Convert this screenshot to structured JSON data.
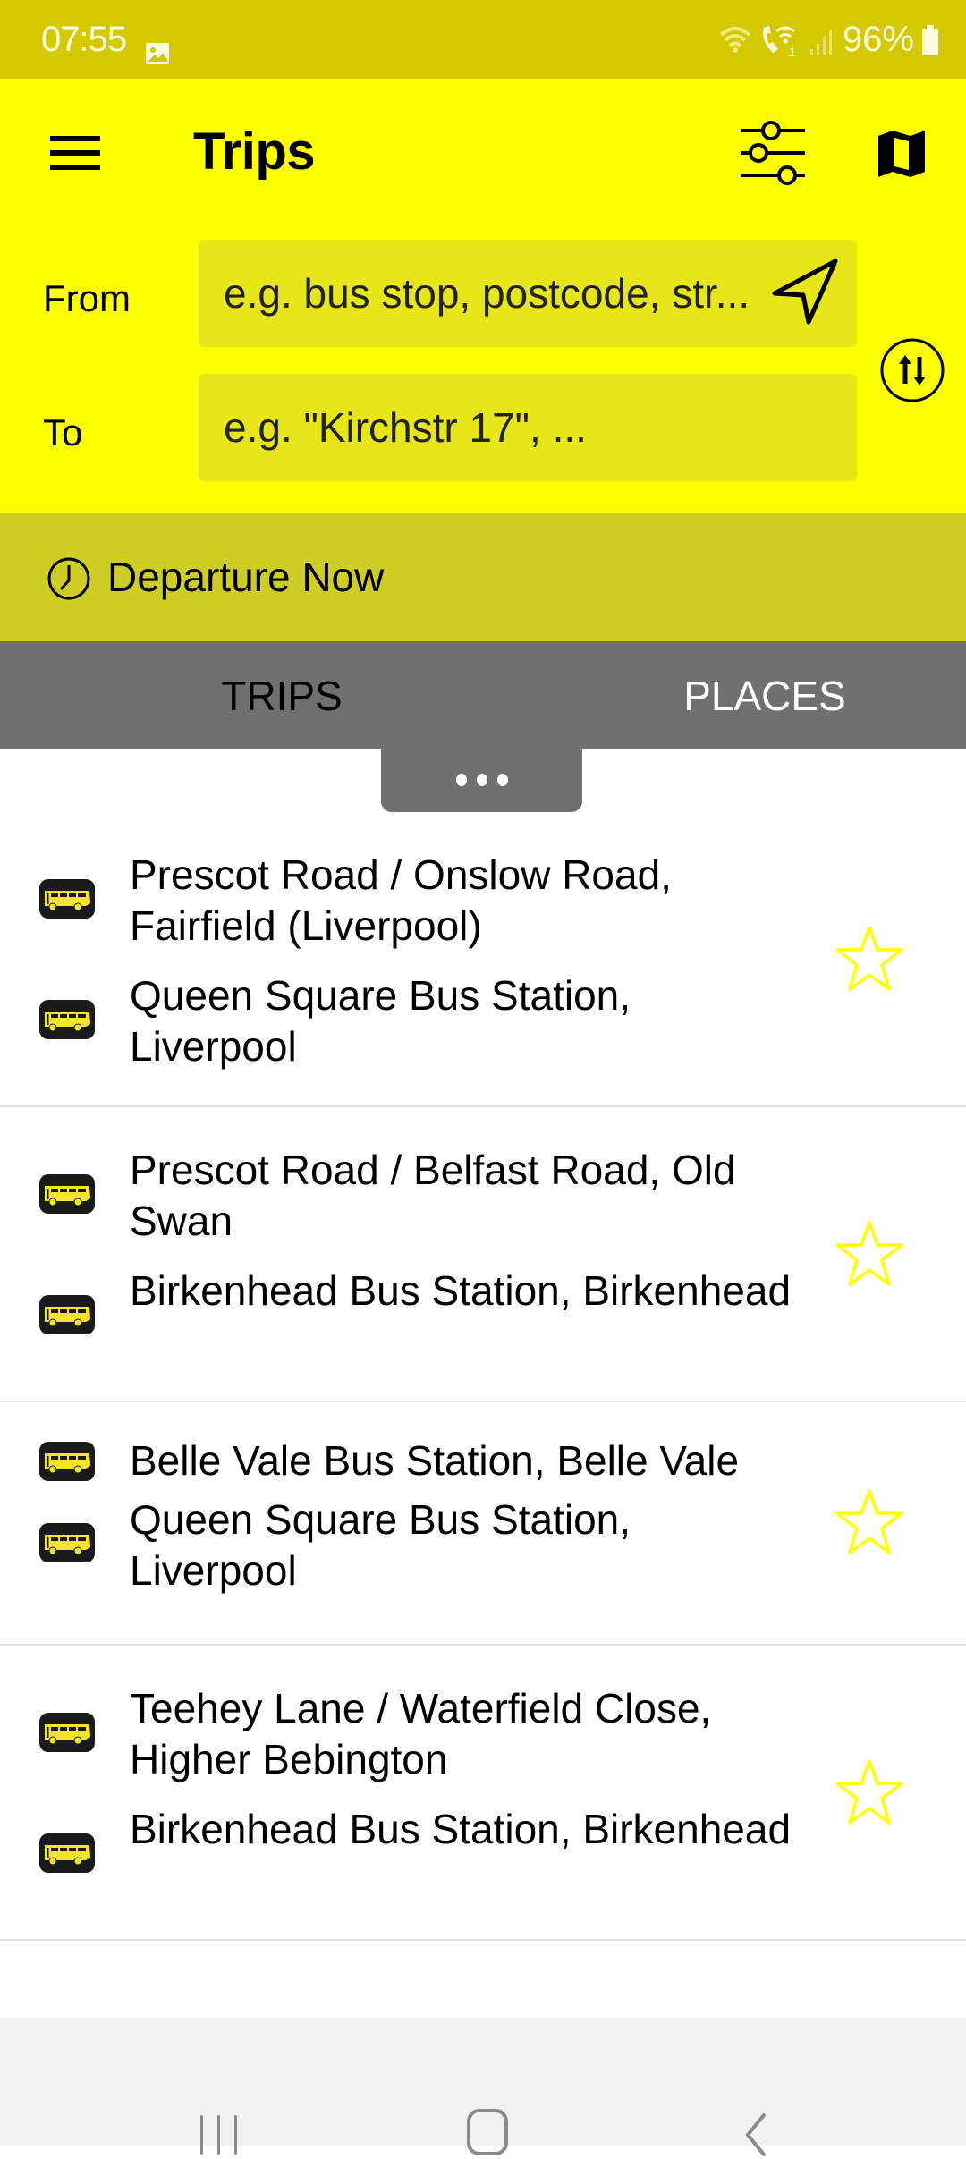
{
  "status_bar": {
    "time": "07:55",
    "battery": "96%",
    "icons": [
      "gallery-icon",
      "wifi-icon",
      "wifi-calling-icon",
      "signal-icon",
      "battery-icon"
    ]
  },
  "app_bar": {
    "title": "Trips",
    "menu_icon": "hamburger-menu-icon",
    "actions": [
      {
        "name": "filter-settings-icon"
      },
      {
        "name": "map-icon"
      }
    ]
  },
  "trip_form": {
    "from": {
      "label": "From",
      "value": "",
      "placeholder": "e.g. bus stop, postcode, str..."
    },
    "to": {
      "label": "To",
      "value": "",
      "placeholder": "e.g. \"Kirchstr 17\", ..."
    },
    "location_icon": "navigation-arrow-icon",
    "swap_icon": "swap-arrows-icon"
  },
  "departure": {
    "label": "Departure Now",
    "icon": "clock-icon"
  },
  "tabs": [
    {
      "label": "TRIPS",
      "selected": true
    },
    {
      "label": "PLACES",
      "selected": false
    }
  ],
  "more_handle": "more-dots-icon",
  "colors": {
    "status_bar": "#D4C800",
    "header": "#FFFF00",
    "field_bg": "#E6E619",
    "departure_bar": "#CDCD25",
    "tab_bar": "#707070",
    "star": "#FFFF00",
    "bus_yellow": "#F5E52A"
  },
  "recent_trips": [
    {
      "from": "Prescot Road / Onslow Road, Fairfield (Liverpool)",
      "to": "Queen Square Bus Station, Liverpool",
      "favorite": false
    },
    {
      "from": "Prescot Road / Belfast Road, Old Swan",
      "to": "Birkenhead Bus Station, Birkenhead",
      "favorite": false
    },
    {
      "from": "Belle Vale Bus Station, Belle Vale",
      "to": "Queen Square Bus Station, Liverpool",
      "favorite": false
    },
    {
      "from": "Teehey Lane / Waterfield Close, Higher Bebington",
      "to": "Birkenhead Bus Station, Birkenhead",
      "favorite": false
    }
  ],
  "nav_bar": {
    "buttons": [
      "recent-apps-icon",
      "home-icon",
      "back-icon"
    ]
  }
}
